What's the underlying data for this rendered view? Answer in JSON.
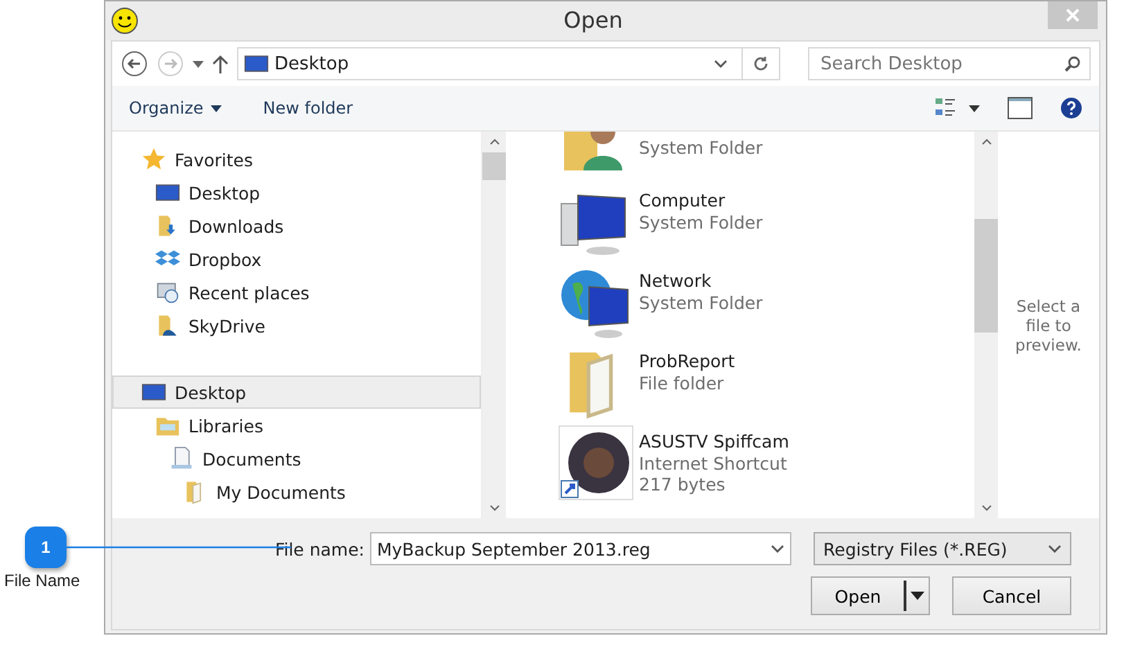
{
  "window": {
    "title": "Open"
  },
  "nav": {
    "address": "Desktop",
    "search": {
      "placeholder": "Search Desktop"
    }
  },
  "toolbar": {
    "organize": "Organize",
    "new_folder": "New folder"
  },
  "tree": [
    {
      "label": "Favorites",
      "kind": "star",
      "selected": false,
      "children": [
        {
          "label": "Desktop",
          "kind": "desktop",
          "selected": false
        },
        {
          "label": "Downloads",
          "kind": "downloads",
          "selected": false
        },
        {
          "label": "Dropbox",
          "kind": "dropbox",
          "selected": false
        },
        {
          "label": "Recent places",
          "kind": "recent",
          "selected": false
        },
        {
          "label": "SkyDrive",
          "kind": "skydrive",
          "selected": false
        }
      ]
    },
    {
      "label": "Desktop",
      "kind": "desktop",
      "selected": true,
      "children": [
        {
          "label": "Libraries",
          "kind": "libraries",
          "selected": false,
          "children": [
            {
              "label": "Documents",
              "kind": "documents",
              "selected": false,
              "children": [
                {
                  "label": "My Documents",
                  "kind": "folder",
                  "selected": false
                }
              ]
            }
          ]
        }
      ]
    }
  ],
  "files": [
    {
      "kind": "user",
      "details": [
        "System Folder"
      ]
    },
    {
      "kind": "computer",
      "name": "Computer",
      "details": [
        "System Folder"
      ]
    },
    {
      "kind": "network",
      "name": "Network",
      "details": [
        "System Folder"
      ]
    },
    {
      "kind": "folder",
      "name": "ProbReport",
      "details": [
        "File folder"
      ]
    },
    {
      "kind": "shortcut",
      "name": "ASUSTV Spiffcam",
      "details": [
        "Internet Shortcut",
        "217 bytes"
      ]
    }
  ],
  "preview": {
    "message": "Select a file to preview."
  },
  "bottom": {
    "file_name_label": "File name:",
    "file_name": "MyBackup September 2013.reg",
    "file_type": "Registry Files (*.REG)",
    "open": "Open",
    "cancel": "Cancel"
  },
  "callout": {
    "number": "1",
    "label": "File Name"
  }
}
